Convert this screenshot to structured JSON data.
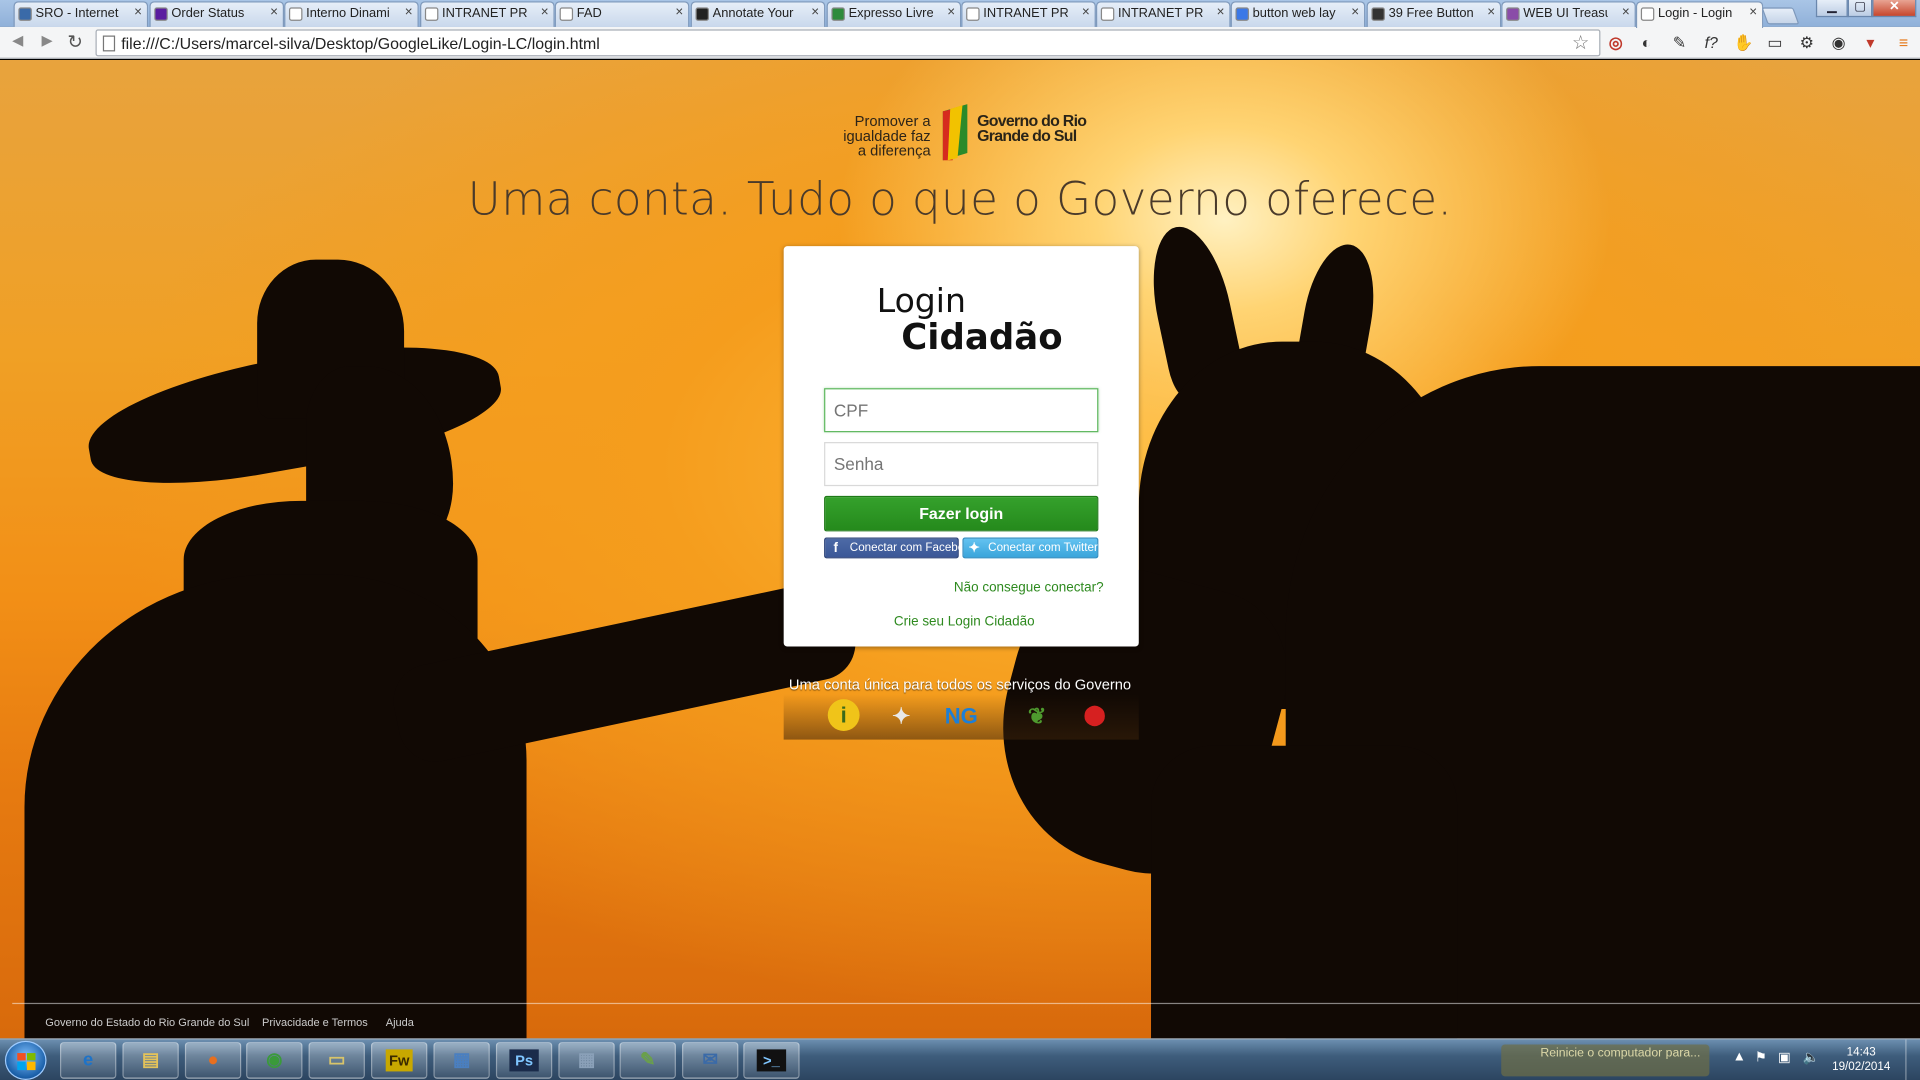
{
  "browser": {
    "tabs": [
      {
        "label": "SRO - Internet",
        "favicon_color": "#3a6aa8"
      },
      {
        "label": "Order Status",
        "favicon_color": "#5a1ca0"
      },
      {
        "label": "Interno Dinami",
        "favicon_color": "#ffffff"
      },
      {
        "label": "INTRANET PRO",
        "favicon_color": "#ffffff"
      },
      {
        "label": "FAD",
        "favicon_color": "#ffffff"
      },
      {
        "label": "Annotate Your",
        "favicon_color": "#222222"
      },
      {
        "label": "Expresso Livre",
        "favicon_color": "#2e8b3c"
      },
      {
        "label": "INTRANET PRO",
        "favicon_color": "#ffffff"
      },
      {
        "label": "INTRANET PRO",
        "favicon_color": "#ffffff"
      },
      {
        "label": "button web lay",
        "favicon_color": "#3b78e7"
      },
      {
        "label": "39 Free Button",
        "favicon_color": "#333333"
      },
      {
        "label": "WEB UI Treasu",
        "favicon_color": "#8a4ca8"
      },
      {
        "label": "Login - Login C",
        "favicon_color": "#ffffff"
      }
    ],
    "active_tab_index": 12,
    "address": "file:///C:/Users/marcel-silva/Desktop/GoogleLike/Login-LC/login.html"
  },
  "page": {
    "logo": {
      "slogan": "Promover a igualdade faz a diferença",
      "gov_name": "Governo do Rio Grande do Sul"
    },
    "tagline": "Uma conta. Tudo o que o Governo oferece.",
    "card": {
      "brand_line1": "Login",
      "brand_line2": "Cidadão",
      "cpf_placeholder": "CPF",
      "password_placeholder": "Senha",
      "login_button": "Fazer login",
      "facebook_button": "Conectar com Facebook",
      "twitter_button": "Conectar com Twitter",
      "help_link": "Não consegue conectar?",
      "create_link": "Crie seu Login Cidadão"
    },
    "unique_account_text": "Uma conta única para todos os serviços do Governo",
    "services": [
      {
        "icon": "info-service-icon",
        "glyph": "i",
        "color": "#f0c419"
      },
      {
        "icon": "state-map-service-icon",
        "glyph": "✦",
        "color": "#e8e8e8"
      },
      {
        "icon": "procergs-service-icon",
        "glyph": "NG",
        "color": "#1d7fd6"
      },
      {
        "icon": "leaves-service-icon",
        "glyph": "❦",
        "color": "#4e9a2e"
      },
      {
        "icon": "map-pin-service-icon",
        "glyph": "⬤",
        "color": "#d62020"
      }
    ],
    "footer_links": [
      "Governo do Estado do Rio Grande do Sul",
      "Privacidade e Termos",
      "Ajuda"
    ],
    "colors": {
      "accent_green": "#258a1c",
      "facebook_blue": "#3b5797",
      "twitter_blue": "#3aa5db",
      "sunset_orange": "#f28f16"
    }
  },
  "taskbar": {
    "pinned": [
      {
        "name": "internet-explorer",
        "glyph": "e"
      },
      {
        "name": "file-explorer",
        "glyph": "▤"
      },
      {
        "name": "firefox",
        "glyph": "●"
      },
      {
        "name": "chrome",
        "glyph": "◉"
      },
      {
        "name": "folder",
        "glyph": "▭"
      },
      {
        "name": "fireworks",
        "glyph": "Fw"
      },
      {
        "name": "windows-explorer",
        "glyph": "▦"
      },
      {
        "name": "photoshop",
        "glyph": "Ps"
      },
      {
        "name": "calculator",
        "glyph": "▦"
      },
      {
        "name": "notepad",
        "glyph": "✎"
      },
      {
        "name": "thunderbird",
        "glyph": "✉"
      },
      {
        "name": "command-prompt",
        "glyph": ">_"
      }
    ],
    "notification_text": "Reinicie o computador para...",
    "time": "14:43",
    "date": "19/02/2014"
  }
}
